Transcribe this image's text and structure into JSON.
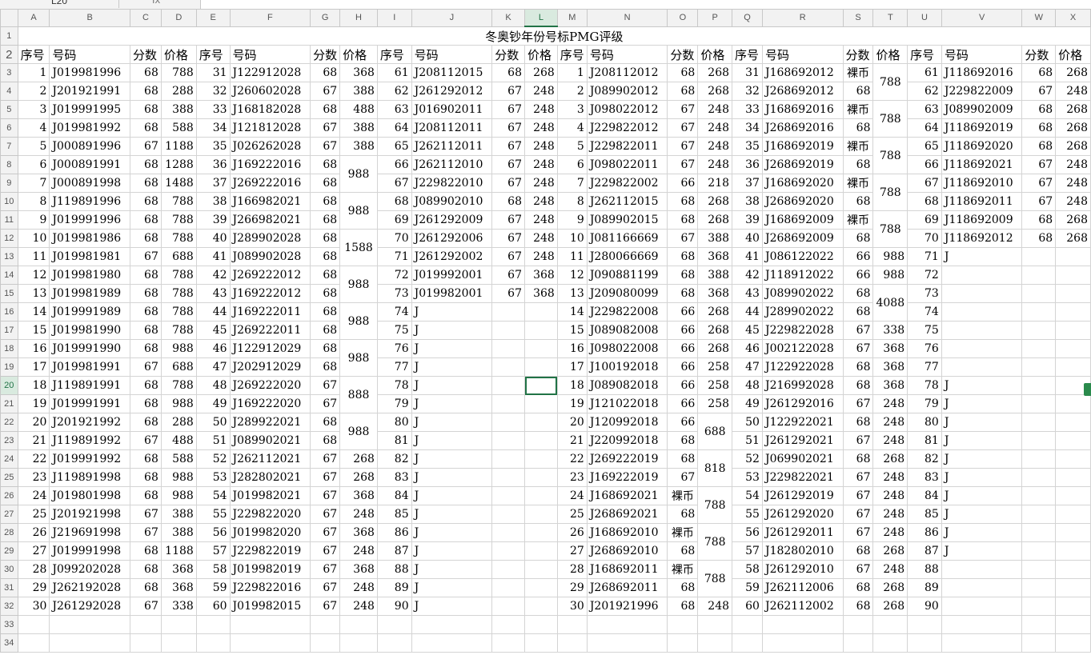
{
  "name_box": "L20",
  "fx_label": "fx",
  "columns": [
    "A",
    "B",
    "C",
    "D",
    "E",
    "F",
    "G",
    "H",
    "I",
    "J",
    "K",
    "L",
    "M",
    "N",
    "O",
    "P",
    "Q",
    "R",
    "S",
    "T",
    "U",
    "V",
    "W",
    "X"
  ],
  "selected_col": "L",
  "selected_row": 20,
  "active_cell": "L20",
  "title": "冬奥钞年份号标PMG评级",
  "headers": [
    "序号",
    "号码",
    "分数",
    "价格",
    "序号",
    "号码",
    "分数",
    "价格",
    "序号",
    "号码",
    "分数",
    "价格",
    "序号",
    "号码",
    "分数",
    "价格",
    "序号",
    "号码",
    "分数",
    "价格",
    "序号",
    "号码",
    "分数",
    "价格"
  ],
  "group1": [
    [
      "1",
      "J019981996",
      "68",
      "788"
    ],
    [
      "2",
      "J201921991",
      "68",
      "288"
    ],
    [
      "3",
      "J019991995",
      "68",
      "388"
    ],
    [
      "4",
      "J019981992",
      "68",
      "588"
    ],
    [
      "5",
      "J000891996",
      "67",
      "1188"
    ],
    [
      "6",
      "J000891991",
      "68",
      "1288"
    ],
    [
      "7",
      "J000891998",
      "68",
      "1488"
    ],
    [
      "8",
      "J119891996",
      "68",
      "788"
    ],
    [
      "9",
      "J019991996",
      "68",
      "788"
    ],
    [
      "10",
      "J019981986",
      "68",
      "788"
    ],
    [
      "11",
      "J019981981",
      "67",
      "688"
    ],
    [
      "12",
      "J019981980",
      "68",
      "788"
    ],
    [
      "13",
      "J019981989",
      "68",
      "788"
    ],
    [
      "14",
      "J019991989",
      "68",
      "788"
    ],
    [
      "15",
      "J019981990",
      "68",
      "788"
    ],
    [
      "16",
      "J019991990",
      "68",
      "988"
    ],
    [
      "17",
      "J019981991",
      "67",
      "688"
    ],
    [
      "18",
      "J119891991",
      "68",
      "788"
    ],
    [
      "19",
      "J019991991",
      "68",
      "988"
    ],
    [
      "20",
      "J201921992",
      "68",
      "288"
    ],
    [
      "21",
      "J119891992",
      "67",
      "488"
    ],
    [
      "22",
      "J019991992",
      "68",
      "588"
    ],
    [
      "23",
      "J119891998",
      "68",
      "988"
    ],
    [
      "24",
      "J019801998",
      "68",
      "988"
    ],
    [
      "25",
      "J201921998",
      "67",
      "388"
    ],
    [
      "26",
      "J219691998",
      "67",
      "388"
    ],
    [
      "27",
      "J019991998",
      "68",
      "1188"
    ],
    [
      "28",
      "J099202028",
      "68",
      "368"
    ],
    [
      "29",
      "J262192028",
      "68",
      "368"
    ],
    [
      "30",
      "J261292028",
      "67",
      "338"
    ]
  ],
  "group2": [
    [
      "31",
      "J122912028",
      "68",
      "368"
    ],
    [
      "32",
      "J260602028",
      "67",
      "388"
    ],
    [
      "33",
      "J168182028",
      "68",
      "488"
    ],
    [
      "34",
      "J121812028",
      "67",
      "388"
    ],
    [
      "35",
      "J026262028",
      "67",
      "388"
    ],
    [
      "36",
      "J169222016",
      "68",
      ""
    ],
    [
      "37",
      "J269222016",
      "68",
      ""
    ],
    [
      "38",
      "J166982021",
      "68",
      ""
    ],
    [
      "39",
      "J266982021",
      "68",
      ""
    ],
    [
      "40",
      "J289902028",
      "68",
      ""
    ],
    [
      "41",
      "J089902028",
      "68",
      ""
    ],
    [
      "42",
      "J269222012",
      "68",
      ""
    ],
    [
      "43",
      "J169222012",
      "68",
      ""
    ],
    [
      "44",
      "J169222011",
      "68",
      ""
    ],
    [
      "45",
      "J269222011",
      "68",
      ""
    ],
    [
      "46",
      "J122912029",
      "68",
      ""
    ],
    [
      "47",
      "J202912029",
      "68",
      ""
    ],
    [
      "48",
      "J269222020",
      "67",
      ""
    ],
    [
      "49",
      "J169222020",
      "67",
      ""
    ],
    [
      "50",
      "J289922021",
      "68",
      ""
    ],
    [
      "51",
      "J089902021",
      "68",
      ""
    ],
    [
      "52",
      "J262112021",
      "67",
      "268"
    ],
    [
      "53",
      "J282802021",
      "67",
      "268"
    ],
    [
      "54",
      "J019982021",
      "67",
      "368"
    ],
    [
      "55",
      "J229822020",
      "67",
      "248"
    ],
    [
      "56",
      "J019982020",
      "67",
      "368"
    ],
    [
      "57",
      "J229822019",
      "67",
      "248"
    ],
    [
      "58",
      "J019982019",
      "67",
      "368"
    ],
    [
      "59",
      "J229822016",
      "67",
      "248"
    ],
    [
      "60",
      "J019982015",
      "67",
      "248"
    ]
  ],
  "group2_merged": [
    {
      "start": 6,
      "span": 2,
      "value": "988"
    },
    {
      "start": 8,
      "span": 2,
      "value": "988"
    },
    {
      "start": 10,
      "span": 2,
      "value": "1588"
    },
    {
      "start": 12,
      "span": 2,
      "value": "988"
    },
    {
      "start": 14,
      "span": 2,
      "value": "988"
    },
    {
      "start": 16,
      "span": 2,
      "value": "988"
    },
    {
      "start": 18,
      "span": 2,
      "value": "888"
    },
    {
      "start": 20,
      "span": 2,
      "value": "988"
    }
  ],
  "group3": [
    [
      "61",
      "J208112015",
      "68",
      "268"
    ],
    [
      "62",
      "J261292012",
      "67",
      "248"
    ],
    [
      "63",
      "J016902011",
      "67",
      "248"
    ],
    [
      "64",
      "J208112011",
      "67",
      "248"
    ],
    [
      "65",
      "J262112011",
      "67",
      "248"
    ],
    [
      "66",
      "J262112010",
      "67",
      "248"
    ],
    [
      "67",
      "J229822010",
      "67",
      "248"
    ],
    [
      "68",
      "J089902010",
      "68",
      "248"
    ],
    [
      "69",
      "J261292009",
      "67",
      "248"
    ],
    [
      "70",
      "J261292006",
      "67",
      "248"
    ],
    [
      "71",
      "J261292002",
      "67",
      "248"
    ],
    [
      "72",
      "J019992001",
      "67",
      "368"
    ],
    [
      "73",
      "J019982001",
      "67",
      "368"
    ],
    [
      "74",
      "J",
      "",
      ""
    ],
    [
      "75",
      "J",
      "",
      ""
    ],
    [
      "76",
      "J",
      "",
      ""
    ],
    [
      "77",
      "J",
      "",
      ""
    ],
    [
      "78",
      "J",
      "",
      ""
    ],
    [
      "79",
      "J",
      "",
      ""
    ],
    [
      "80",
      "J",
      "",
      ""
    ],
    [
      "81",
      "J",
      "",
      ""
    ],
    [
      "82",
      "J",
      "",
      ""
    ],
    [
      "83",
      "J",
      "",
      ""
    ],
    [
      "84",
      "J",
      "",
      ""
    ],
    [
      "85",
      "J",
      "",
      ""
    ],
    [
      "86",
      "J",
      "",
      ""
    ],
    [
      "87",
      "J",
      "",
      ""
    ],
    [
      "88",
      "J",
      "",
      ""
    ],
    [
      "89",
      "J",
      "",
      ""
    ],
    [
      "90",
      "J",
      "",
      ""
    ]
  ],
  "group4": [
    [
      "1",
      "J208112012",
      "68",
      "268"
    ],
    [
      "2",
      "J089902012",
      "68",
      "268"
    ],
    [
      "3",
      "J098022012",
      "67",
      "248"
    ],
    [
      "4",
      "J229822012",
      "67",
      "248"
    ],
    [
      "5",
      "J229822011",
      "67",
      "248"
    ],
    [
      "6",
      "J098022011",
      "67",
      "248"
    ],
    [
      "7",
      "J229822002",
      "66",
      "218"
    ],
    [
      "8",
      "J262112015",
      "68",
      "268"
    ],
    [
      "9",
      "J089902015",
      "68",
      "268"
    ],
    [
      "10",
      "J081166669",
      "67",
      "388"
    ],
    [
      "11",
      "J280066669",
      "68",
      "368"
    ],
    [
      "12",
      "J090881199",
      "68",
      "388"
    ],
    [
      "13",
      "J209080099",
      "68",
      "368"
    ],
    [
      "14",
      "J229822008",
      "66",
      "268"
    ],
    [
      "15",
      "J089082008",
      "66",
      "268"
    ],
    [
      "16",
      "J098022008",
      "66",
      "268"
    ],
    [
      "17",
      "J100192018",
      "66",
      "258"
    ],
    [
      "18",
      "J089082018",
      "66",
      "258"
    ],
    [
      "19",
      "J121022018",
      "66",
      "258"
    ],
    [
      "20",
      "J120992018",
      "66",
      ""
    ],
    [
      "21",
      "J220992018",
      "68",
      ""
    ],
    [
      "22",
      "J269222019",
      "68",
      ""
    ],
    [
      "23",
      "J169222019",
      "67",
      ""
    ],
    [
      "24",
      "J168692021",
      "裸币",
      ""
    ],
    [
      "25",
      "J268692021",
      "68",
      ""
    ],
    [
      "26",
      "J168692010",
      "裸币",
      ""
    ],
    [
      "27",
      "J268692010",
      "68",
      ""
    ],
    [
      "28",
      "J168692011",
      "裸币",
      ""
    ],
    [
      "29",
      "J268692011",
      "68",
      ""
    ],
    [
      "30",
      "J201921996",
      "68",
      "248"
    ]
  ],
  "group4_merged": [
    {
      "start": 20,
      "span": 2,
      "value": "688"
    },
    {
      "start": 22,
      "span": 2,
      "value": "818"
    },
    {
      "start": 24,
      "span": 2,
      "value": "788"
    },
    {
      "start": 26,
      "span": 2,
      "value": "788"
    },
    {
      "start": 28,
      "span": 2,
      "value": "788"
    }
  ],
  "group5": [
    [
      "31",
      "J168692012",
      "裸币",
      ""
    ],
    [
      "32",
      "J268692012",
      "68",
      ""
    ],
    [
      "33",
      "J168692016",
      "裸币",
      ""
    ],
    [
      "34",
      "J268692016",
      "68",
      ""
    ],
    [
      "35",
      "J168692019",
      "裸币",
      ""
    ],
    [
      "36",
      "J268692019",
      "68",
      ""
    ],
    [
      "37",
      "J168692020",
      "裸币",
      ""
    ],
    [
      "38",
      "J268692020",
      "68",
      ""
    ],
    [
      "39",
      "J168692009",
      "裸币",
      ""
    ],
    [
      "40",
      "J268692009",
      "68",
      ""
    ],
    [
      "41",
      "J086122022",
      "66",
      "988"
    ],
    [
      "42",
      "J118912022",
      "66",
      "988"
    ],
    [
      "43",
      "J089902022",
      "68",
      ""
    ],
    [
      "44",
      "J289902022",
      "68",
      ""
    ],
    [
      "45",
      "J229822028",
      "67",
      "338"
    ],
    [
      "46",
      "J002122028",
      "67",
      "368"
    ],
    [
      "47",
      "J122922028",
      "68",
      "368"
    ],
    [
      "48",
      "J216992028",
      "68",
      "368"
    ],
    [
      "49",
      "J261292016",
      "67",
      "248"
    ],
    [
      "50",
      "J122922021",
      "68",
      "248"
    ],
    [
      "51",
      "J261292021",
      "67",
      "248"
    ],
    [
      "52",
      "J069902021",
      "68",
      "268"
    ],
    [
      "53",
      "J229822021",
      "67",
      "248"
    ],
    [
      "54",
      "J261292019",
      "67",
      "248"
    ],
    [
      "55",
      "J261292020",
      "67",
      "248"
    ],
    [
      "56",
      "J261292011",
      "67",
      "248"
    ],
    [
      "57",
      "J182802010",
      "68",
      "268"
    ],
    [
      "58",
      "J261292010",
      "67",
      "248"
    ],
    [
      "59",
      "J262112006",
      "68",
      "268"
    ],
    [
      "60",
      "J262112002",
      "68",
      "268"
    ]
  ],
  "group5_merged": [
    {
      "start": 1,
      "span": 2,
      "value": "788"
    },
    {
      "start": 3,
      "span": 2,
      "value": "788"
    },
    {
      "start": 5,
      "span": 2,
      "value": "788"
    },
    {
      "start": 7,
      "span": 2,
      "value": "788"
    },
    {
      "start": 9,
      "span": 2,
      "value": "788"
    },
    {
      "start": 13,
      "span": 2,
      "value": "4088"
    }
  ],
  "group6": [
    [
      "61",
      "J118692016",
      "68",
      "268"
    ],
    [
      "62",
      "J229822009",
      "67",
      "248"
    ],
    [
      "63",
      "J089902009",
      "68",
      "268"
    ],
    [
      "64",
      "J118692019",
      "68",
      "268"
    ],
    [
      "65",
      "J118692020",
      "68",
      "268"
    ],
    [
      "66",
      "J118692021",
      "67",
      "248"
    ],
    [
      "67",
      "J118692010",
      "67",
      "248"
    ],
    [
      "68",
      "J118692011",
      "67",
      "248"
    ],
    [
      "69",
      "J118692009",
      "68",
      "268"
    ],
    [
      "70",
      "J118692012",
      "68",
      "268"
    ],
    [
      "71",
      "J",
      "",
      ""
    ],
    [
      "72",
      "",
      "",
      ""
    ],
    [
      "73",
      "",
      "",
      ""
    ],
    [
      "74",
      "",
      "",
      ""
    ],
    [
      "75",
      "",
      "",
      ""
    ],
    [
      "76",
      "",
      "",
      ""
    ],
    [
      "77",
      "",
      "",
      ""
    ],
    [
      "78",
      "J",
      "",
      ""
    ],
    [
      "79",
      "J",
      "",
      ""
    ],
    [
      "80",
      "J",
      "",
      ""
    ],
    [
      "81",
      "J",
      "",
      ""
    ],
    [
      "82",
      "J",
      "",
      ""
    ],
    [
      "83",
      "J",
      "",
      ""
    ],
    [
      "84",
      "J",
      "",
      ""
    ],
    [
      "85",
      "J",
      "",
      ""
    ],
    [
      "86",
      "J",
      "",
      ""
    ],
    [
      "87",
      "J",
      "",
      ""
    ],
    [
      "88",
      "",
      "",
      ""
    ],
    [
      "89",
      "",
      "",
      ""
    ],
    [
      "90",
      "",
      "",
      ""
    ]
  ]
}
